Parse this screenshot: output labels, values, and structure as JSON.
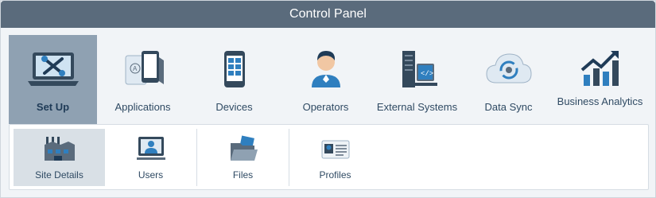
{
  "window": {
    "title": "Control Panel"
  },
  "main_tiles": [
    {
      "label": "Set Up",
      "icon": "laptop-tools-icon",
      "active": true
    },
    {
      "label": "Applications",
      "icon": "applications-icon"
    },
    {
      "label": "Devices",
      "icon": "mobile-device-icon"
    },
    {
      "label": "Operators",
      "icon": "operator-icon"
    },
    {
      "label": "External Systems",
      "icon": "server-icon"
    },
    {
      "label": "Data Sync",
      "icon": "cloud-sync-icon"
    },
    {
      "label": "Business Analytics",
      "icon": "analytics-chart-icon"
    }
  ],
  "sub_tiles": [
    {
      "label": "Site Details",
      "icon": "factory-icon",
      "active": true
    },
    {
      "label": "Users",
      "icon": "user-monitor-icon"
    },
    {
      "label": "Files",
      "icon": "folder-files-icon"
    },
    {
      "label": "Profiles",
      "icon": "profile-card-icon"
    }
  ],
  "colors": {
    "titlebar": "#5a6b7c",
    "active_tile": "#8fa1b2",
    "accent_blue": "#2f7fbf",
    "text": "#2f4a63"
  }
}
